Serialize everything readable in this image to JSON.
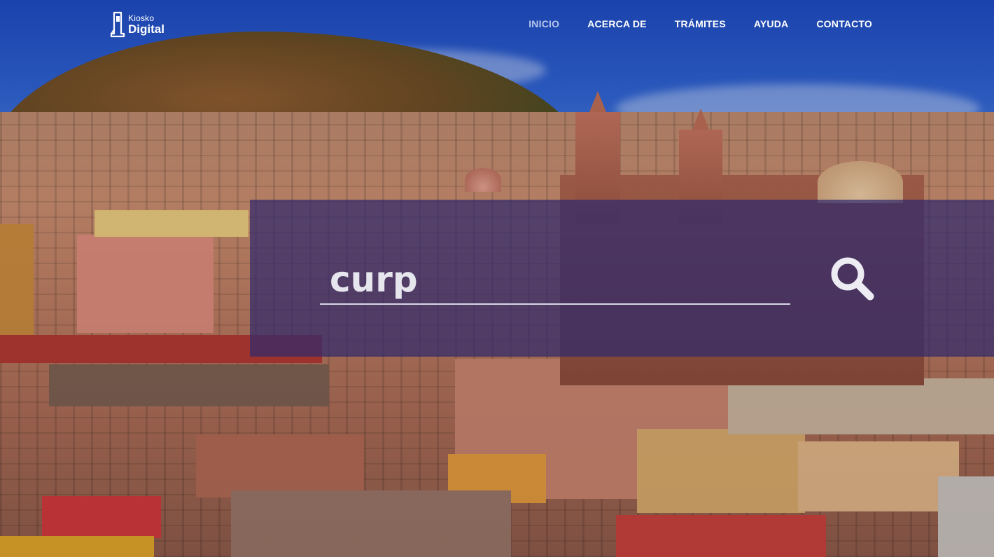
{
  "brand": {
    "top_label": "Kiosko",
    "bottom_label": "Digital"
  },
  "nav": {
    "items": [
      {
        "label": "INICIO",
        "active": true
      },
      {
        "label": "ACERCA DE"
      },
      {
        "label": "TRÁMITES"
      },
      {
        "label": "AYUDA"
      },
      {
        "label": "CONTACTO"
      }
    ]
  },
  "search": {
    "value": "curp",
    "icon": "search-icon"
  },
  "colors": {
    "band_overlay": "#302a6c",
    "active_nav": "#b7c6ee",
    "text": "#ffffff"
  }
}
